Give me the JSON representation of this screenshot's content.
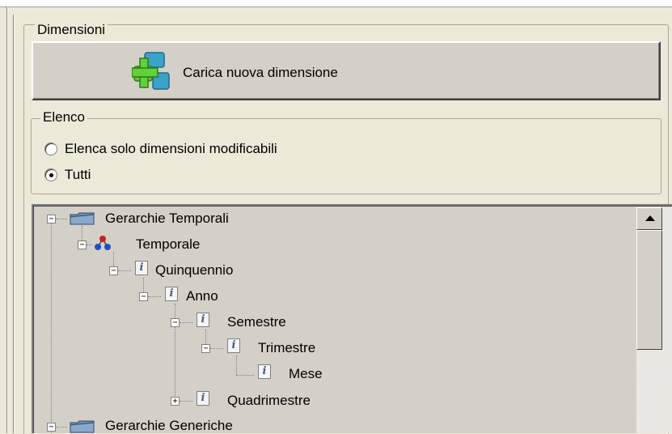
{
  "dimensions_group": {
    "title": "Dimensioni",
    "load_button_label": "Carica nuova dimensione",
    "load_button_icon": "add-dimension-icon"
  },
  "elenco_group": {
    "title": "Elenco",
    "options": [
      {
        "label": "Elenca solo dimensioni modificabili",
        "selected": false
      },
      {
        "label": "Tutti",
        "selected": true
      }
    ]
  },
  "tree": {
    "nodes": [
      {
        "label": "Gerarchie Temporali",
        "icon": "folder-icon",
        "expanded": true,
        "depth": 0
      },
      {
        "label": "Temporale",
        "icon": "hierarchy-icon",
        "expanded": true,
        "depth": 1
      },
      {
        "label": "Quinquennio",
        "icon": "info-icon",
        "expanded": true,
        "depth": 2
      },
      {
        "label": "Anno",
        "icon": "info-icon",
        "expanded": true,
        "depth": 3
      },
      {
        "label": "Semestre",
        "icon": "info-icon",
        "expanded": true,
        "depth": 4
      },
      {
        "label": "Trimestre",
        "icon": "info-icon",
        "expanded": true,
        "depth": 5
      },
      {
        "label": "Mese",
        "icon": "info-icon",
        "expanded": null,
        "depth": 6
      },
      {
        "label": "Quadrimestre",
        "icon": "info-icon",
        "expanded": false,
        "depth": 4
      },
      {
        "label": "Gerarchie Generiche",
        "icon": "folder-icon",
        "expanded": true,
        "depth": 0
      }
    ],
    "info_glyph": "i",
    "expander_collapse": "−",
    "expander_expand": "+"
  },
  "colors": {
    "window_bg": "#ece9d8",
    "button_face": "#d4d0c8",
    "folder_blue": "#6b8fb5",
    "hierarchy_red": "#cc2020",
    "hierarchy_blue": "#2050c0"
  }
}
